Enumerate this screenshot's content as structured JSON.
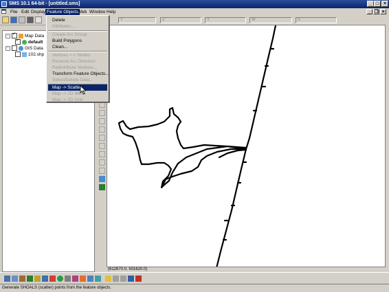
{
  "window": {
    "title": "SMS 10.1 64-bit - [untitled.sms]",
    "minimize_icon": "minimize-icon",
    "maximize_icon": "maximize-icon",
    "close_icon": "close-icon"
  },
  "menubar": {
    "items": [
      "File",
      "Edit",
      "Display",
      "Feature Objects",
      "Web",
      "Window",
      "Help"
    ],
    "active": "Feature Objects"
  },
  "toolbar": {
    "coord_labels": [
      "X",
      "Y",
      "Z",
      "W",
      "S"
    ]
  },
  "feature_objects_menu": {
    "items": [
      {
        "label": "Delete",
        "enabled": true
      },
      {
        "label": "Attributes...",
        "enabled": false
      },
      {
        "label": "Create Arc Group",
        "enabled": false
      },
      {
        "label": "Build Polygons",
        "enabled": true
      },
      {
        "label": "Clean...",
        "enabled": true
      },
      {
        "label": "Vertices <-> Nodes",
        "enabled": false
      },
      {
        "label": "Reverse Arc Direction",
        "enabled": false
      },
      {
        "label": "Redistribute Vertices...",
        "enabled": false
      },
      {
        "label": "Transform Feature Objects...",
        "enabled": true
      },
      {
        "label": "Select/Delete Data...",
        "enabled": false
      },
      {
        "label": "Map -> Scatter",
        "enabled": true,
        "highlighted": true
      },
      {
        "label": "Map -> 2D Mesh",
        "enabled": false
      },
      {
        "label": "Map -> 2D Grid",
        "enabled": false
      }
    ]
  },
  "project_explorer": {
    "map_data": "Map Data",
    "coverage": "default",
    "gis_data": "GIS Data",
    "shapefile": "102.shp"
  },
  "canvas": {
    "cursor_coords": "(612670.0, 501620.0)"
  },
  "statusbar": {
    "text": "Generate SHOALS (scatter) points from the feature objects."
  },
  "colors": {
    "titlebar": "#0a246a",
    "chrome": "#d4d0c8",
    "highlight": "#0a246a"
  }
}
